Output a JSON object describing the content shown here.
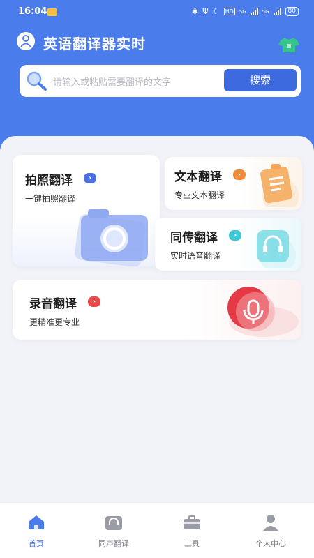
{
  "status_bar": {
    "time": "16:04",
    "signal_a": "5G",
    "signal_b": "5G",
    "battery": "80",
    "hd": "HD"
  },
  "header": {
    "app_title": "英语翻译器实时"
  },
  "search": {
    "placeholder": "请输入或粘贴需要翻译的文字",
    "button_label": "搜索"
  },
  "cards": {
    "photo": {
      "title": "拍照翻译",
      "subtitle": "一键拍照翻译",
      "accent": "#4a6fe0"
    },
    "text": {
      "title": "文本翻译",
      "subtitle": "专业文本翻译",
      "accent": "#ef8a38"
    },
    "simultaneous": {
      "title": "同传翻译",
      "subtitle": "实时语音翻译",
      "accent": "#3ec8d8"
    },
    "record": {
      "title": "录音翻译",
      "subtitle": "更精准更专业",
      "accent": "#e84a4a"
    }
  },
  "tabbar": {
    "items": [
      {
        "label": "首页",
        "icon": "home-icon",
        "active": true
      },
      {
        "label": "同声翻译",
        "icon": "headset-icon",
        "active": false
      },
      {
        "label": "工具",
        "icon": "toolbox-icon",
        "active": false
      },
      {
        "label": "个人中心",
        "icon": "person-icon",
        "active": false
      }
    ]
  },
  "colors": {
    "primary": "#4a7cec",
    "button": "#3e6ae0",
    "background": "#f2f3f8"
  }
}
